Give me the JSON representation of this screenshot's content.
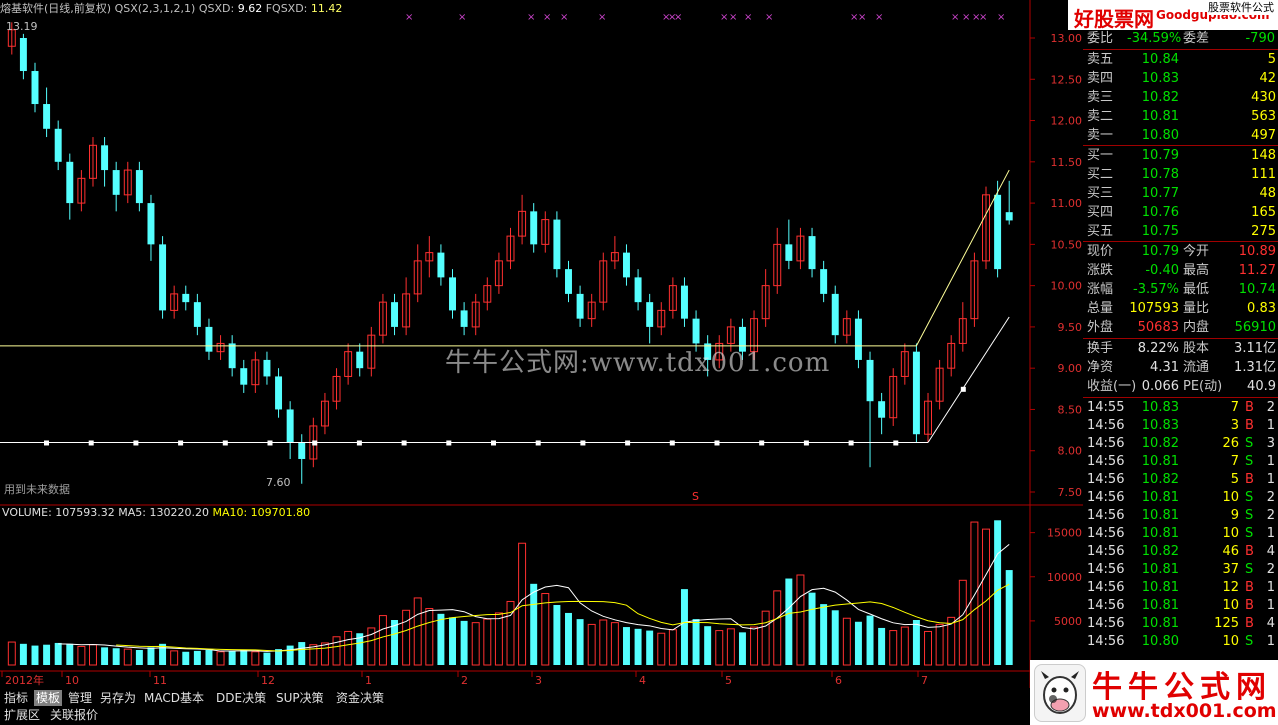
{
  "header": {
    "stock_name": "熔基软件(日线,前复权)",
    "qsx": "QSX(2,3,1,2,1)",
    "qsxd_label": "QSXD:",
    "qsxd_value": "9.62",
    "fqsxd_label": "FQSXD:",
    "fqsxd_value": "11.42"
  },
  "chart_labels": {
    "high_marker": "13.19",
    "low_marker": "7.60",
    "future_note": "用到未来数据",
    "s_marker": "S",
    "volume_label": "VOLUME: 107593.32",
    "ma5_label": "MA5: 130220.20",
    "ma10_label": "MA10: 109701.80"
  },
  "price_axis": [
    "13.00",
    "12.50",
    "12.00",
    "11.50",
    "11.00",
    "10.50",
    "10.00",
    "9.50",
    "9.00",
    "8.50",
    "8.00",
    "7.50"
  ],
  "volume_axis": [
    "15000",
    "10000",
    "5000"
  ],
  "date_axis": [
    "2012年",
    "10",
    "11",
    "12",
    "1",
    "2",
    "3",
    "4",
    "5",
    "6",
    "7"
  ],
  "chart_data": {
    "type": "candlestick",
    "ylim": [
      7.5,
      13.0
    ],
    "volume_ylim": [
      0,
      15000
    ],
    "bars": [
      {
        "o": 12.9,
        "c": 13.1,
        "h": 13.19,
        "l": 12.8,
        "v": 2600
      },
      {
        "o": 13.0,
        "c": 12.6,
        "h": 13.05,
        "l": 12.5,
        "v": 2400
      },
      {
        "o": 12.6,
        "c": 12.2,
        "h": 12.7,
        "l": 12.1,
        "v": 2200
      },
      {
        "o": 12.2,
        "c": 11.9,
        "h": 12.4,
        "l": 11.8,
        "v": 2300
      },
      {
        "o": 11.9,
        "c": 11.5,
        "h": 12.0,
        "l": 11.4,
        "v": 2500
      },
      {
        "o": 11.5,
        "c": 11.0,
        "h": 11.6,
        "l": 10.8,
        "v": 2400
      },
      {
        "o": 11.0,
        "c": 11.3,
        "h": 11.4,
        "l": 10.9,
        "v": 2100
      },
      {
        "o": 11.3,
        "c": 11.7,
        "h": 11.8,
        "l": 11.2,
        "v": 2300
      },
      {
        "o": 11.7,
        "c": 11.4,
        "h": 11.8,
        "l": 11.2,
        "v": 2000
      },
      {
        "o": 11.4,
        "c": 11.1,
        "h": 11.5,
        "l": 10.9,
        "v": 1900
      },
      {
        "o": 11.1,
        "c": 11.4,
        "h": 11.5,
        "l": 11.0,
        "v": 1800
      },
      {
        "o": 11.4,
        "c": 11.0,
        "h": 11.5,
        "l": 10.9,
        "v": 1700
      },
      {
        "o": 11.0,
        "c": 10.5,
        "h": 11.1,
        "l": 10.3,
        "v": 2000
      },
      {
        "o": 10.5,
        "c": 9.7,
        "h": 10.6,
        "l": 9.6,
        "v": 2400
      },
      {
        "o": 9.7,
        "c": 9.9,
        "h": 10.0,
        "l": 9.6,
        "v": 1600
      },
      {
        "o": 9.9,
        "c": 9.8,
        "h": 10.0,
        "l": 9.7,
        "v": 1500
      },
      {
        "o": 9.8,
        "c": 9.5,
        "h": 9.9,
        "l": 9.4,
        "v": 1600
      },
      {
        "o": 9.5,
        "c": 9.2,
        "h": 9.6,
        "l": 9.1,
        "v": 1700
      },
      {
        "o": 9.2,
        "c": 9.3,
        "h": 9.4,
        "l": 9.1,
        "v": 1500
      },
      {
        "o": 9.3,
        "c": 9.0,
        "h": 9.4,
        "l": 8.9,
        "v": 1600
      },
      {
        "o": 9.0,
        "c": 8.8,
        "h": 9.1,
        "l": 8.7,
        "v": 1700
      },
      {
        "o": 8.8,
        "c": 9.1,
        "h": 9.2,
        "l": 8.7,
        "v": 1500
      },
      {
        "o": 9.1,
        "c": 8.9,
        "h": 9.2,
        "l": 8.8,
        "v": 1400
      },
      {
        "o": 8.9,
        "c": 8.5,
        "h": 9.0,
        "l": 8.4,
        "v": 1800
      },
      {
        "o": 8.5,
        "c": 8.1,
        "h": 8.6,
        "l": 7.9,
        "v": 2200
      },
      {
        "o": 8.1,
        "c": 7.9,
        "h": 8.2,
        "l": 7.6,
        "v": 2600
      },
      {
        "o": 7.9,
        "c": 8.3,
        "h": 8.4,
        "l": 7.8,
        "v": 2300
      },
      {
        "o": 8.3,
        "c": 8.6,
        "h": 8.7,
        "l": 8.2,
        "v": 2500
      },
      {
        "o": 8.6,
        "c": 8.9,
        "h": 9.0,
        "l": 8.5,
        "v": 3200
      },
      {
        "o": 8.9,
        "c": 9.2,
        "h": 9.3,
        "l": 8.8,
        "v": 3800
      },
      {
        "o": 9.2,
        "c": 9.0,
        "h": 9.3,
        "l": 8.9,
        "v": 3600
      },
      {
        "o": 9.0,
        "c": 9.4,
        "h": 9.5,
        "l": 8.9,
        "v": 4200
      },
      {
        "o": 9.4,
        "c": 9.8,
        "h": 9.9,
        "l": 9.3,
        "v": 5600
      },
      {
        "o": 9.8,
        "c": 9.5,
        "h": 9.9,
        "l": 9.4,
        "v": 5100
      },
      {
        "o": 9.5,
        "c": 9.9,
        "h": 10.1,
        "l": 9.4,
        "v": 6200
      },
      {
        "o": 9.9,
        "c": 10.3,
        "h": 10.5,
        "l": 9.8,
        "v": 7600
      },
      {
        "o": 10.3,
        "c": 10.4,
        "h": 10.6,
        "l": 10.1,
        "v": 6400
      },
      {
        "o": 10.4,
        "c": 10.1,
        "h": 10.5,
        "l": 10.0,
        "v": 5800
      },
      {
        "o": 10.1,
        "c": 9.7,
        "h": 10.2,
        "l": 9.6,
        "v": 5400
      },
      {
        "o": 9.7,
        "c": 9.5,
        "h": 9.8,
        "l": 9.4,
        "v": 5000
      },
      {
        "o": 9.5,
        "c": 9.8,
        "h": 9.9,
        "l": 9.4,
        "v": 4800
      },
      {
        "o": 9.8,
        "c": 10.0,
        "h": 10.1,
        "l": 9.7,
        "v": 5200
      },
      {
        "o": 10.0,
        "c": 10.3,
        "h": 10.4,
        "l": 9.9,
        "v": 5900
      },
      {
        "o": 10.3,
        "c": 10.6,
        "h": 10.7,
        "l": 10.2,
        "v": 7200
      },
      {
        "o": 10.6,
        "c": 10.9,
        "h": 11.1,
        "l": 10.5,
        "v": 13800
      },
      {
        "o": 10.9,
        "c": 10.5,
        "h": 11.0,
        "l": 10.4,
        "v": 9200
      },
      {
        "o": 10.5,
        "c": 10.8,
        "h": 10.9,
        "l": 10.4,
        "v": 8100
      },
      {
        "o": 10.8,
        "c": 10.2,
        "h": 10.9,
        "l": 10.1,
        "v": 6800
      },
      {
        "o": 10.2,
        "c": 9.9,
        "h": 10.3,
        "l": 9.8,
        "v": 5900
      },
      {
        "o": 9.9,
        "c": 9.6,
        "h": 10.0,
        "l": 9.5,
        "v": 5200
      },
      {
        "o": 9.6,
        "c": 9.8,
        "h": 9.9,
        "l": 9.5,
        "v": 4600
      },
      {
        "o": 9.8,
        "c": 10.3,
        "h": 10.4,
        "l": 9.7,
        "v": 5100
      },
      {
        "o": 10.3,
        "c": 10.4,
        "h": 10.6,
        "l": 10.2,
        "v": 4800
      },
      {
        "o": 10.4,
        "c": 10.1,
        "h": 10.5,
        "l": 10.0,
        "v": 4300
      },
      {
        "o": 10.1,
        "c": 9.8,
        "h": 10.2,
        "l": 9.7,
        "v": 4100
      },
      {
        "o": 9.8,
        "c": 9.5,
        "h": 9.9,
        "l": 9.3,
        "v": 3900
      },
      {
        "o": 9.5,
        "c": 9.7,
        "h": 9.8,
        "l": 9.4,
        "v": 3600
      },
      {
        "o": 9.7,
        "c": 10.0,
        "h": 10.1,
        "l": 9.6,
        "v": 4000
      },
      {
        "o": 10.0,
        "c": 9.6,
        "h": 10.1,
        "l": 9.5,
        "v": 8600
      },
      {
        "o": 9.6,
        "c": 9.3,
        "h": 9.7,
        "l": 9.2,
        "v": 5200
      },
      {
        "o": 9.3,
        "c": 9.1,
        "h": 9.4,
        "l": 8.9,
        "v": 4400
      },
      {
        "o": 9.1,
        "c": 9.3,
        "h": 9.4,
        "l": 9.0,
        "v": 3900
      },
      {
        "o": 9.3,
        "c": 9.5,
        "h": 9.6,
        "l": 9.2,
        "v": 4100
      },
      {
        "o": 9.5,
        "c": 9.2,
        "h": 9.6,
        "l": 9.1,
        "v": 3700
      },
      {
        "o": 9.2,
        "c": 9.6,
        "h": 9.7,
        "l": 9.1,
        "v": 4300
      },
      {
        "o": 9.6,
        "c": 10.0,
        "h": 10.2,
        "l": 9.5,
        "v": 6100
      },
      {
        "o": 10.0,
        "c": 10.5,
        "h": 10.7,
        "l": 9.9,
        "v": 8400
      },
      {
        "o": 10.5,
        "c": 10.3,
        "h": 10.8,
        "l": 10.2,
        "v": 9800
      },
      {
        "o": 10.3,
        "c": 10.6,
        "h": 10.7,
        "l": 10.2,
        "v": 10200
      },
      {
        "o": 10.6,
        "c": 10.2,
        "h": 10.7,
        "l": 10.1,
        "v": 8200
      },
      {
        "o": 10.2,
        "c": 9.9,
        "h": 10.3,
        "l": 9.8,
        "v": 6900
      },
      {
        "o": 9.9,
        "c": 9.4,
        "h": 10.0,
        "l": 9.3,
        "v": 6200
      },
      {
        "o": 9.4,
        "c": 9.6,
        "h": 9.7,
        "l": 9.3,
        "v": 5300
      },
      {
        "o": 9.6,
        "c": 9.1,
        "h": 9.7,
        "l": 9.0,
        "v": 4900
      },
      {
        "o": 9.1,
        "c": 8.6,
        "h": 9.2,
        "l": 7.8,
        "v": 5600
      },
      {
        "o": 8.6,
        "c": 8.4,
        "h": 8.7,
        "l": 8.2,
        "v": 4200
      },
      {
        "o": 8.4,
        "c": 8.9,
        "h": 9.0,
        "l": 8.3,
        "v": 3900
      },
      {
        "o": 8.9,
        "c": 9.2,
        "h": 9.3,
        "l": 8.8,
        "v": 4300
      },
      {
        "o": 9.2,
        "c": 8.2,
        "h": 9.3,
        "l": 8.1,
        "v": 5100
      },
      {
        "o": 8.2,
        "c": 8.6,
        "h": 8.7,
        "l": 8.1,
        "v": 3800
      },
      {
        "o": 8.6,
        "c": 9.0,
        "h": 9.1,
        "l": 8.5,
        "v": 4600
      },
      {
        "o": 9.0,
        "c": 9.3,
        "h": 9.4,
        "l": 8.9,
        "v": 5400
      },
      {
        "o": 9.3,
        "c": 9.6,
        "h": 9.8,
        "l": 9.2,
        "v": 9600
      },
      {
        "o": 9.6,
        "c": 10.3,
        "h": 10.4,
        "l": 9.5,
        "v": 16200
      },
      {
        "o": 10.3,
        "c": 11.1,
        "h": 11.2,
        "l": 10.2,
        "v": 15400
      },
      {
        "o": 11.1,
        "c": 10.2,
        "h": 11.27,
        "l": 10.1,
        "v": 16400
      },
      {
        "o": 10.89,
        "c": 10.79,
        "h": 11.27,
        "l": 10.74,
        "v": 10759
      }
    ],
    "support_line": 8.1,
    "resistance_line": 9.27
  },
  "quote": {
    "weibi": {
      "label": "委比",
      "value": "-34.59%",
      "label2": "委差",
      "value2": "-790"
    },
    "asks": [
      {
        "label": "卖五",
        "price": "10.84",
        "vol": "5"
      },
      {
        "label": "卖四",
        "price": "10.83",
        "vol": "42"
      },
      {
        "label": "卖三",
        "price": "10.82",
        "vol": "430"
      },
      {
        "label": "卖二",
        "price": "10.81",
        "vol": "563"
      },
      {
        "label": "卖一",
        "price": "10.80",
        "vol": "497"
      }
    ],
    "bids": [
      {
        "label": "买一",
        "price": "10.79",
        "vol": "148"
      },
      {
        "label": "买二",
        "price": "10.78",
        "vol": "111"
      },
      {
        "label": "买三",
        "price": "10.77",
        "vol": "48"
      },
      {
        "label": "买四",
        "price": "10.76",
        "vol": "165"
      },
      {
        "label": "买五",
        "price": "10.75",
        "vol": "275"
      }
    ],
    "stats": [
      {
        "l1": "现价",
        "v1": "10.79",
        "c1": "green",
        "l2": "今开",
        "v2": "10.89",
        "c2": "red"
      },
      {
        "l1": "涨跌",
        "v1": "-0.40",
        "c1": "green",
        "l2": "最高",
        "v2": "11.27",
        "c2": "red"
      },
      {
        "l1": "涨幅",
        "v1": "-3.57%",
        "c1": "green",
        "l2": "最低",
        "v2": "10.74",
        "c2": "green"
      },
      {
        "l1": "总量",
        "v1": "107593",
        "c1": "yel",
        "l2": "量比",
        "v2": "0.83",
        "c2": "yel"
      },
      {
        "l1": "外盘",
        "v1": "50683",
        "c1": "red",
        "l2": "内盘",
        "v2": "56910",
        "c2": "green"
      }
    ],
    "stats2": [
      {
        "l1": "换手",
        "v1": "8.22%",
        "l2": "股本",
        "v2": "3.11亿"
      },
      {
        "l1": "净资",
        "v1": "4.31",
        "l2": "流通",
        "v2": "1.31亿"
      },
      {
        "l1": "收益(一)",
        "v1": "0.066",
        "l2": "PE(动)",
        "v2": "40.9"
      }
    ],
    "ticks": [
      {
        "t": "14:55",
        "p": "10.83",
        "v": "7",
        "d": "B",
        "n": "2"
      },
      {
        "t": "14:56",
        "p": "10.83",
        "v": "3",
        "d": "B",
        "n": "1"
      },
      {
        "t": "14:56",
        "p": "10.82",
        "v": "26",
        "d": "S",
        "n": "3"
      },
      {
        "t": "14:56",
        "p": "10.81",
        "v": "7",
        "d": "S",
        "n": "1"
      },
      {
        "t": "14:56",
        "p": "10.82",
        "v": "5",
        "d": "B",
        "n": "1"
      },
      {
        "t": "14:56",
        "p": "10.81",
        "v": "10",
        "d": "S",
        "n": "2"
      },
      {
        "t": "14:56",
        "p": "10.81",
        "v": "9",
        "d": "S",
        "n": "2"
      },
      {
        "t": "14:56",
        "p": "10.81",
        "v": "10",
        "d": "S",
        "n": "1"
      },
      {
        "t": "14:56",
        "p": "10.82",
        "v": "46",
        "d": "B",
        "n": "4"
      },
      {
        "t": "14:56",
        "p": "10.81",
        "v": "37",
        "d": "S",
        "n": "2"
      },
      {
        "t": "14:56",
        "p": "10.81",
        "v": "12",
        "d": "B",
        "n": "1"
      },
      {
        "t": "14:56",
        "p": "10.81",
        "v": "10",
        "d": "B",
        "n": "1"
      },
      {
        "t": "14:56",
        "p": "10.81",
        "v": "125",
        "d": "B",
        "n": "4"
      },
      {
        "t": "14:56",
        "p": "10.80",
        "v": "10",
        "d": "S",
        "n": "1"
      }
    ]
  },
  "tabs_row1": [
    "指标",
    "模板",
    "管理",
    "另存为",
    "MACD基本",
    "DDE决策",
    "SUP决策",
    "资金决策"
  ],
  "tabs_row2": [
    "扩展区",
    "关联报价"
  ],
  "watermark": "牛牛公式网:www.tdx001.com",
  "logo_top": {
    "text": "好股票网",
    "sub": "Goodgupiao.com",
    "side": "股票软件公式"
  },
  "logo_bottom": {
    "text": "牛牛公式网",
    "url": "www.tdx001.com"
  },
  "colors": {
    "up": "#ff3030",
    "down": "#55ffff",
    "axis": "#b00000",
    "line": "#ffff99",
    "ma5": "#ffffff",
    "ma10": "#ffff00"
  }
}
